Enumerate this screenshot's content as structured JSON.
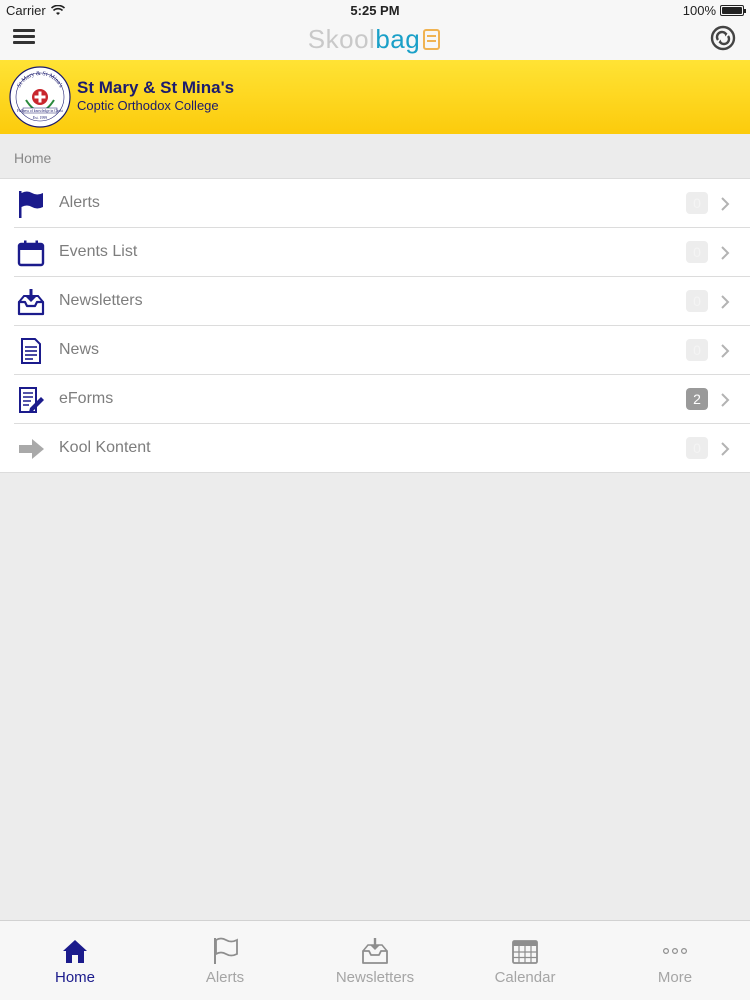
{
  "statusbar": {
    "carrier": "Carrier",
    "time": "5:25 PM",
    "battery": "100%",
    "battery_level": 1.0
  },
  "navbar": {
    "brand_skool": "Skool",
    "brand_bag": "bag",
    "menu_icon": "hamburger-icon",
    "sync_icon": "sync-icon"
  },
  "school": {
    "name": "St Mary & St Mina's",
    "subtitle": "Coptic Orthodox College",
    "crest_top": "St Mary & St Mina's",
    "crest_motto": "Fullness of knowledge in Christ",
    "crest_est": "Est. 1999"
  },
  "breadcrumb": "Home",
  "menu": [
    {
      "label": "Alerts",
      "icon": "flag-icon",
      "badge": "0"
    },
    {
      "label": "Events List",
      "icon": "calendar-icon",
      "badge": "0"
    },
    {
      "label": "Newsletters",
      "icon": "inbox-download-icon",
      "badge": "0"
    },
    {
      "label": "News",
      "icon": "document-icon",
      "badge": "0"
    },
    {
      "label": "eForms",
      "icon": "form-pen-icon",
      "badge": "2"
    },
    {
      "label": "Kool Kontent",
      "icon": "arrow-right-icon",
      "badge": "0"
    }
  ],
  "tabs": [
    {
      "label": "Home",
      "icon": "home-icon"
    },
    {
      "label": "Alerts",
      "icon": "flag-icon"
    },
    {
      "label": "Newsletters",
      "icon": "inbox-download-icon"
    },
    {
      "label": "Calendar",
      "icon": "calendar-grid-icon"
    },
    {
      "label": "More",
      "icon": "more-dots-icon"
    }
  ],
  "colors": {
    "accent": "#1b1b8c",
    "banner": "#fcd20f",
    "brand_bag": "#1aa0c8"
  }
}
